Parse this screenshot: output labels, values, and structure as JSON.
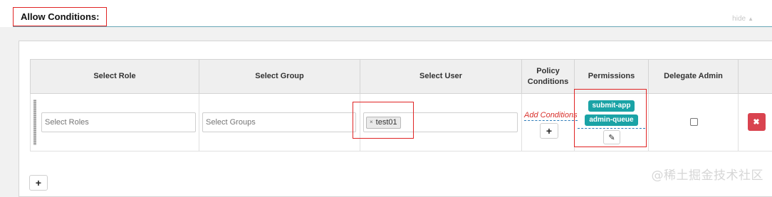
{
  "section": {
    "title": "Allow Conditions:",
    "hide_label": "hide",
    "hide_caret": "▲"
  },
  "table": {
    "columns": [
      "Select Role",
      "Select Group",
      "Select User",
      "Policy\nConditions",
      "Permissions",
      "Delegate Admin"
    ],
    "row": {
      "role_placeholder": "Select Roles",
      "group_placeholder": "Select Groups",
      "users": [
        "test01"
      ],
      "tag_remove_glyph": "×",
      "add_conditions_label": "Add Conditions",
      "plus_glyph": "+",
      "permissions": [
        "submit-app",
        "admin-queue"
      ],
      "edit_glyph": "✎",
      "delegate_admin_checked": false,
      "delete_glyph": "✖"
    }
  },
  "add_row_glyph": "+",
  "watermark": "@稀土掘金技术社区",
  "colors": {
    "permission_badge": "#1aa3a6",
    "delete_button": "#d9434f",
    "highlight_box": "#e02424",
    "link_red": "#d9302b"
  }
}
